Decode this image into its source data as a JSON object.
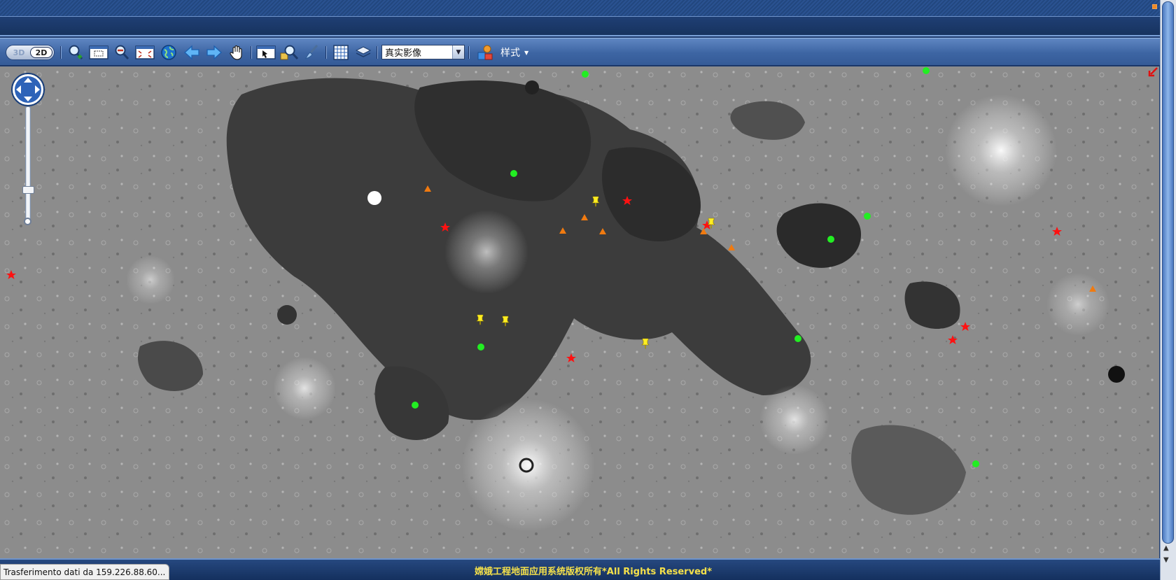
{
  "toolbar": {
    "mode_3d": "3D",
    "mode_2d": "2D",
    "layer_select": {
      "selected": "真实影像"
    },
    "style_label": "样式"
  },
  "icons": {
    "zoom_in": "zoom-in-magnifier-icon",
    "zoom_box": "zoom-box-icon",
    "zoom_out": "zoom-out-magnifier-icon",
    "zoom_out_box": "zoom-out-box-icon",
    "full_extent": "globe-icon",
    "back": "arrow-left-icon",
    "forward": "arrow-right-icon",
    "pan": "hand-icon",
    "select_box": "select-box-icon",
    "identify": "identify-magnifier-icon",
    "clear": "brush-icon",
    "grid": "grid-icon",
    "layers": "layers-icon",
    "style": "style-shapes-icon"
  },
  "colors": {
    "header": "#1c3a6e",
    "toolbar": "#4a72b0",
    "copyright_text": "#f4e04a",
    "marker_star": "#ff1111",
    "marker_dot": "#22ee22",
    "marker_triangle": "#f07a10",
    "marker_pin": "#ffee22"
  },
  "status_text": "Trasferimento dati da 159.226.88.60...",
  "copyright": "嫦娥工程地面应用系统版权所有*All Rights Reserved*"
}
